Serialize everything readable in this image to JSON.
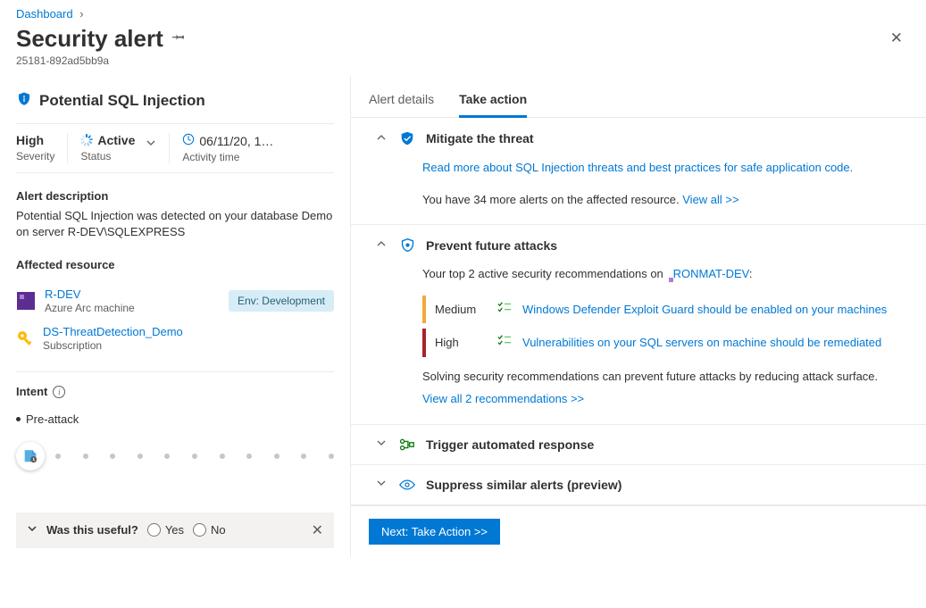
{
  "breadcrumb": {
    "root": "Dashboard"
  },
  "header": {
    "title": "Security alert",
    "subtitle": "25181-892ad5bb9a"
  },
  "alert": {
    "title": "Potential SQL Injection",
    "severity_value": "High",
    "severity_label": "Severity",
    "status_value": "Active",
    "status_label": "Status",
    "activity_value": "06/11/20, 1…",
    "activity_label": "Activity time"
  },
  "description": {
    "heading": "Alert description",
    "text": "Potential SQL Injection was detected on your database Demo on server R-DEV\\SQLEXPRESS"
  },
  "affected": {
    "heading": "Affected resource",
    "items": [
      {
        "name": "R-DEV",
        "type": "Azure Arc machine",
        "badge": "Env: Development"
      },
      {
        "name": "DS-ThreatDetection_Demo",
        "type": "Subscription"
      }
    ]
  },
  "intent": {
    "heading": "Intent",
    "stage": "Pre-attack"
  },
  "useful": {
    "question": "Was this useful?",
    "yes": "Yes",
    "no": "No"
  },
  "tabs": {
    "details": "Alert details",
    "action": "Take action"
  },
  "mitigate": {
    "title": "Mitigate the threat",
    "link": "Read more about SQL Injection threats and best practices for safe application code.",
    "more_prefix": "You have 34 more alerts on the affected resource. ",
    "viewall": "View all >>"
  },
  "prevent": {
    "title": "Prevent future attacks",
    "intro_prefix": "Your top 2 active security recommendations on ",
    "resource_name": "RONMAT-DEV",
    "recs": [
      {
        "sev": "Medium",
        "text": "Windows Defender Exploit Guard should be enabled on your machines"
      },
      {
        "sev": "High",
        "text": "Vulnerabilities on your SQL servers on machine should be remediated"
      }
    ],
    "note": "Solving security recommendations can prevent future attacks by reducing attack surface.",
    "viewall": "View all 2 recommendations >>"
  },
  "trigger": {
    "title": "Trigger automated response"
  },
  "suppress": {
    "title": "Suppress similar alerts (preview)"
  },
  "footer": {
    "next_button": "Next: Take Action >>"
  }
}
